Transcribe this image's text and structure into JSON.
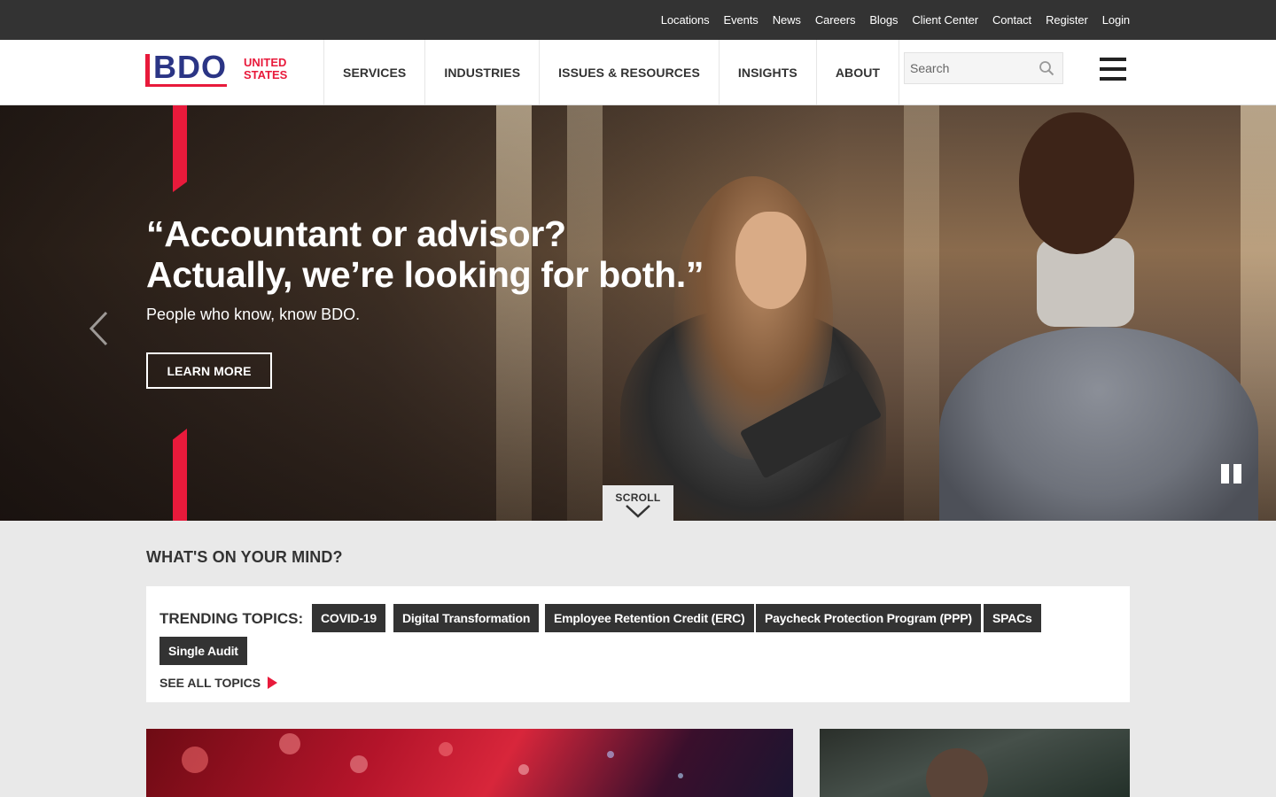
{
  "utility_nav": [
    "Locations",
    "Events",
    "News",
    "Careers",
    "Blogs",
    "Client Center",
    "Contact",
    "Register",
    "Login"
  ],
  "brand": {
    "logo_text": "BDO",
    "country": "UNITED\nSTATES",
    "accent": "#e81a3b",
    "navy": "#2b3585"
  },
  "main_nav": [
    "SERVICES",
    "INDUSTRIES",
    "ISSUES & RESOURCES",
    "INSIGHTS",
    "ABOUT"
  ],
  "search": {
    "placeholder": "Search",
    "icon": "search-icon"
  },
  "menu_icon": "hamburger-icon",
  "hero": {
    "headline_line1": "“Accountant or advisor?",
    "headline_line2": "Actually, we’re looking for both.”",
    "subhead": "People who know, know BDO.",
    "cta": "LEARN MORE",
    "prev_icon": "chevron-left-icon",
    "pause_icon": "pause-icon"
  },
  "scroll": {
    "label": "SCROLL",
    "icon": "chevron-down-icon"
  },
  "trending": {
    "section_title": "WHAT'S ON YOUR MIND?",
    "label": "TRENDING TOPICS:",
    "topics": [
      "COVID-19",
      "Digital Transformation",
      "Employee Retention Credit (ERC)",
      "Paycheck Protection Program (PPP)",
      "SPACs",
      "Single Audit"
    ],
    "see_all": "SEE ALL TOPICS"
  }
}
